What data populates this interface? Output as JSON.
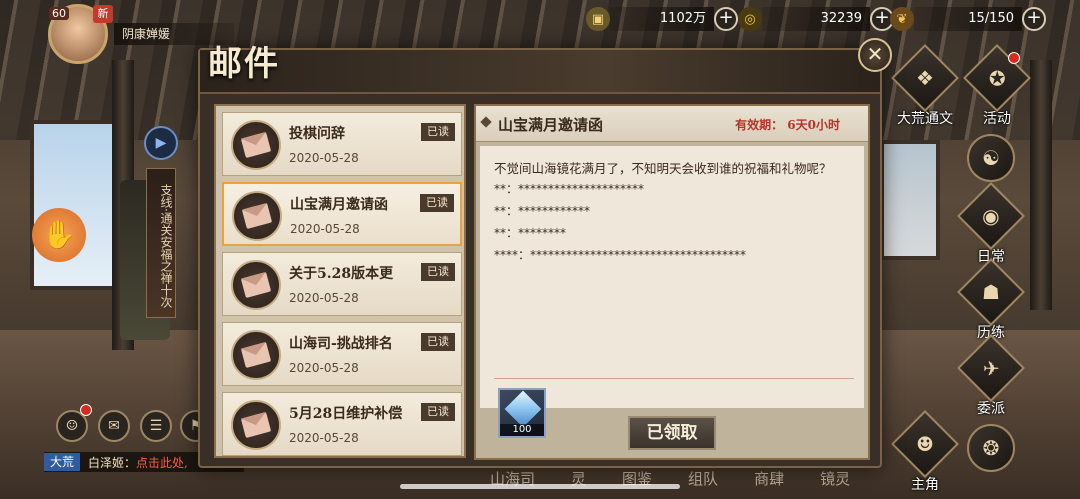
{
  "player": {
    "level": "60",
    "badge": "新",
    "name": "阴康婵媛"
  },
  "resources": [
    {
      "icon": "coin-icon",
      "value": "1102万"
    },
    {
      "icon": "spiral-currency-icon",
      "value": "32239"
    },
    {
      "icon": "stamina-icon",
      "value": "15/150"
    }
  ],
  "mail": {
    "title": "邮件",
    "items": [
      {
        "subject": "投棋问辞",
        "date": "2020-05-28",
        "status": "已读"
      },
      {
        "subject": "山宝满月邀请函",
        "date": "2020-05-28",
        "status": "已读"
      },
      {
        "subject": "关于5.28版本更",
        "date": "2020-05-28",
        "status": "已读"
      },
      {
        "subject": "山海司-挑战排名",
        "date": "2020-05-28",
        "status": "已读"
      },
      {
        "subject": "5月28日维护补偿",
        "date": "2020-05-28",
        "status": "已读"
      }
    ],
    "detail": {
      "title": "山宝满月邀请函",
      "validity": "有效期：  6天0小时",
      "lines": [
        "不觉间山海镜花满月了，不知明天会收到谁的祝福和礼物呢？",
        "**：*********************",
        "**：************",
        "**：********",
        "****：************************************"
      ],
      "reward_count": "100",
      "claim_label": "已领取"
    }
  },
  "side_menu": [
    {
      "label": "大荒通文"
    },
    {
      "label": "活动"
    },
    {
      "label": "日常"
    },
    {
      "label": "历练"
    },
    {
      "label": "委派"
    },
    {
      "label": "主角"
    }
  ],
  "left": {
    "banner": "支线·通关安福之禅十次"
  },
  "chat": {
    "tag": "大荒",
    "name": "白泽姬：",
    "link": "点击此处,"
  },
  "bottom_nav": [
    "山海司",
    "灵",
    "图鉴",
    "组队",
    "商肆",
    "镜灵"
  ]
}
